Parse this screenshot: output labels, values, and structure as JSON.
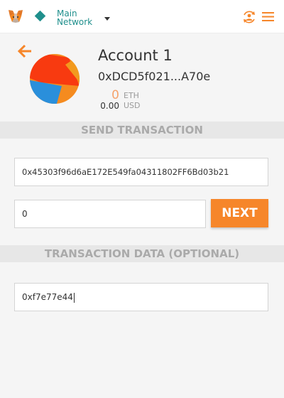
{
  "header": {
    "network_line1": "Main",
    "network_line2": "Network"
  },
  "account": {
    "name": "Account 1",
    "address": "0xDCD5f021...A70e",
    "eth_balance": "0",
    "eth_unit": "ETH",
    "usd_balance": "0.00",
    "usd_unit": "USD"
  },
  "send": {
    "section_title": "SEND TRANSACTION",
    "recipient_value": "0x45303f96d6aE172E549fa04311802FF6Bd03b21",
    "amount_value": "0",
    "next_label": "NEXT"
  },
  "data": {
    "section_title": "TRANSACTION DATA (OPTIONAL)",
    "data_value": "0xf7e77e44"
  },
  "colors": {
    "accent": "#f6862a",
    "network": "#1f8f8c"
  },
  "icons": [
    "metamask-fox-icon",
    "network-diamond-icon",
    "chevron-down-icon",
    "account-switch-icon",
    "hamburger-menu-icon",
    "back-arrow-icon"
  ]
}
